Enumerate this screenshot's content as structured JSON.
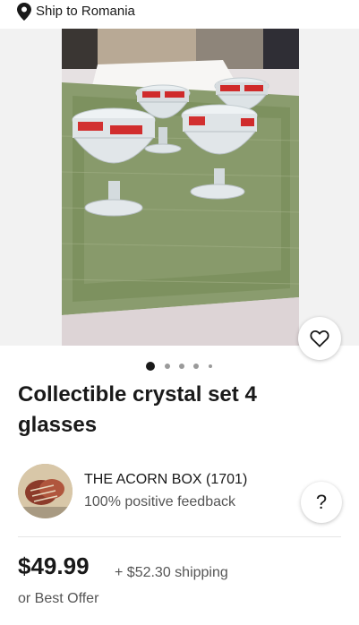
{
  "header": {
    "ship_to": "Ship to Romania"
  },
  "gallery": {
    "image_count": 5,
    "active_index": 0
  },
  "listing": {
    "title": "Collectible crystal set 4 glasses"
  },
  "seller": {
    "name": "THE ACORN BOX (1701)",
    "feedback": "100% positive feedback",
    "help_label": "?"
  },
  "pricing": {
    "price": "$49.99",
    "shipping": "+ $52.30 shipping",
    "offer": "or Best Offer"
  },
  "icons": {
    "location": "map-pin-icon",
    "watch": "heart-icon"
  }
}
